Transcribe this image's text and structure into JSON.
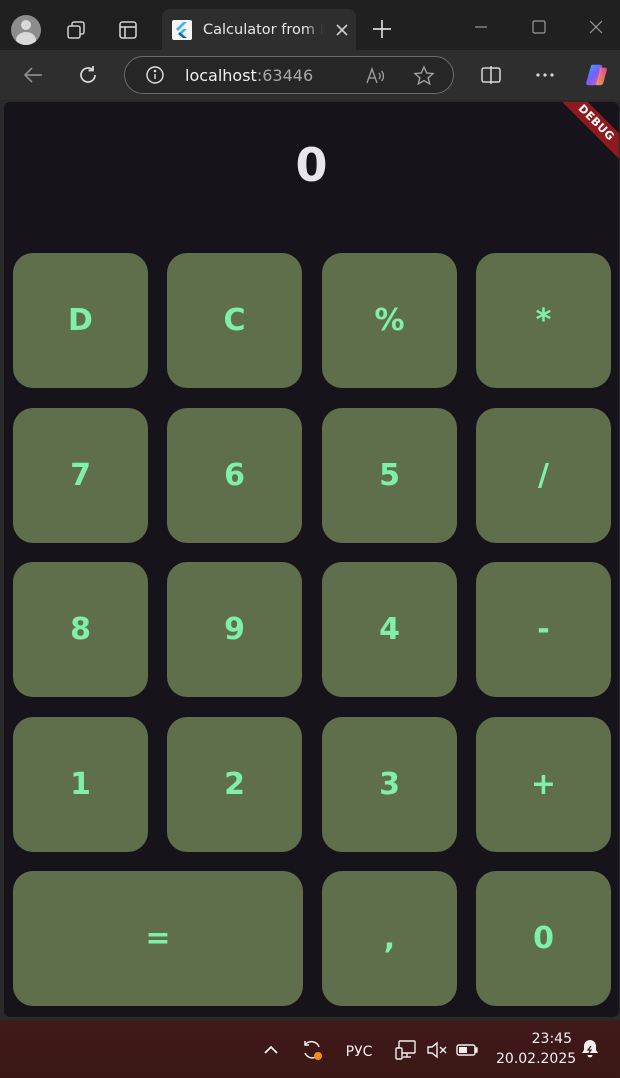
{
  "browser": {
    "tab_title": "Calculator from Kotlin",
    "url_host": "localhost",
    "url_port": ":63446"
  },
  "app": {
    "display_value": "0",
    "debug_banner": "DEBUG",
    "keys": [
      "D",
      "C",
      "%",
      "*",
      "7",
      "6",
      "5",
      "/",
      "8",
      "9",
      "4",
      "-",
      "1",
      "2",
      "3",
      "+",
      "=",
      ",",
      "0"
    ],
    "colors": {
      "background": "#16141a",
      "key_background": "#606f4b",
      "key_text": "#7ff0a8",
      "debug_banner": "#8e1a1f"
    }
  },
  "taskbar": {
    "language": "РУС",
    "time": "23:45",
    "date": "20.02.2025"
  }
}
